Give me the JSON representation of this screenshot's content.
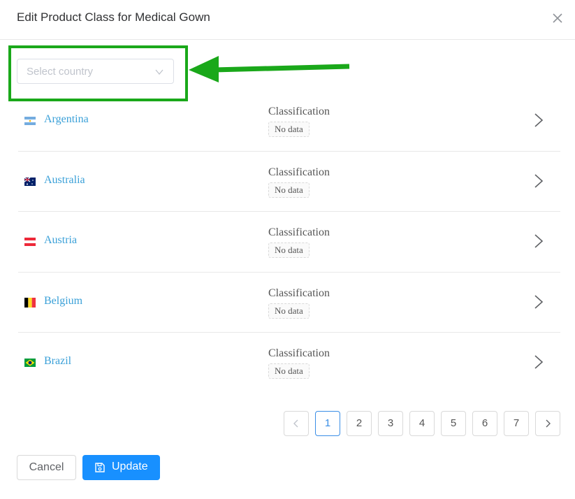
{
  "dialog": {
    "title": "Edit Product Class for Medical Gown"
  },
  "country_select": {
    "placeholder": "Select country"
  },
  "countries": [
    {
      "name": "Argentina",
      "classification_label": "Classification",
      "classification_value": "No data",
      "flag": "argentina-flag-icon"
    },
    {
      "name": "Australia",
      "classification_label": "Classification",
      "classification_value": "No data",
      "flag": "australia-flag-icon"
    },
    {
      "name": "Austria",
      "classification_label": "Classification",
      "classification_value": "No data",
      "flag": "austria-flag-icon"
    },
    {
      "name": "Belgium",
      "classification_label": "Classification",
      "classification_value": "No data",
      "flag": "belgium-flag-icon"
    },
    {
      "name": "Brazil",
      "classification_label": "Classification",
      "classification_value": "No data",
      "flag": "brazil-flag-icon"
    }
  ],
  "pagination": {
    "pages": [
      "1",
      "2",
      "3",
      "4",
      "5",
      "6",
      "7"
    ],
    "current": "1"
  },
  "footer": {
    "cancel_label": "Cancel",
    "update_label": "Update"
  },
  "colors": {
    "accent": "#1890ff",
    "link": "#3aa0d8",
    "annotation": "#1aa81a"
  }
}
